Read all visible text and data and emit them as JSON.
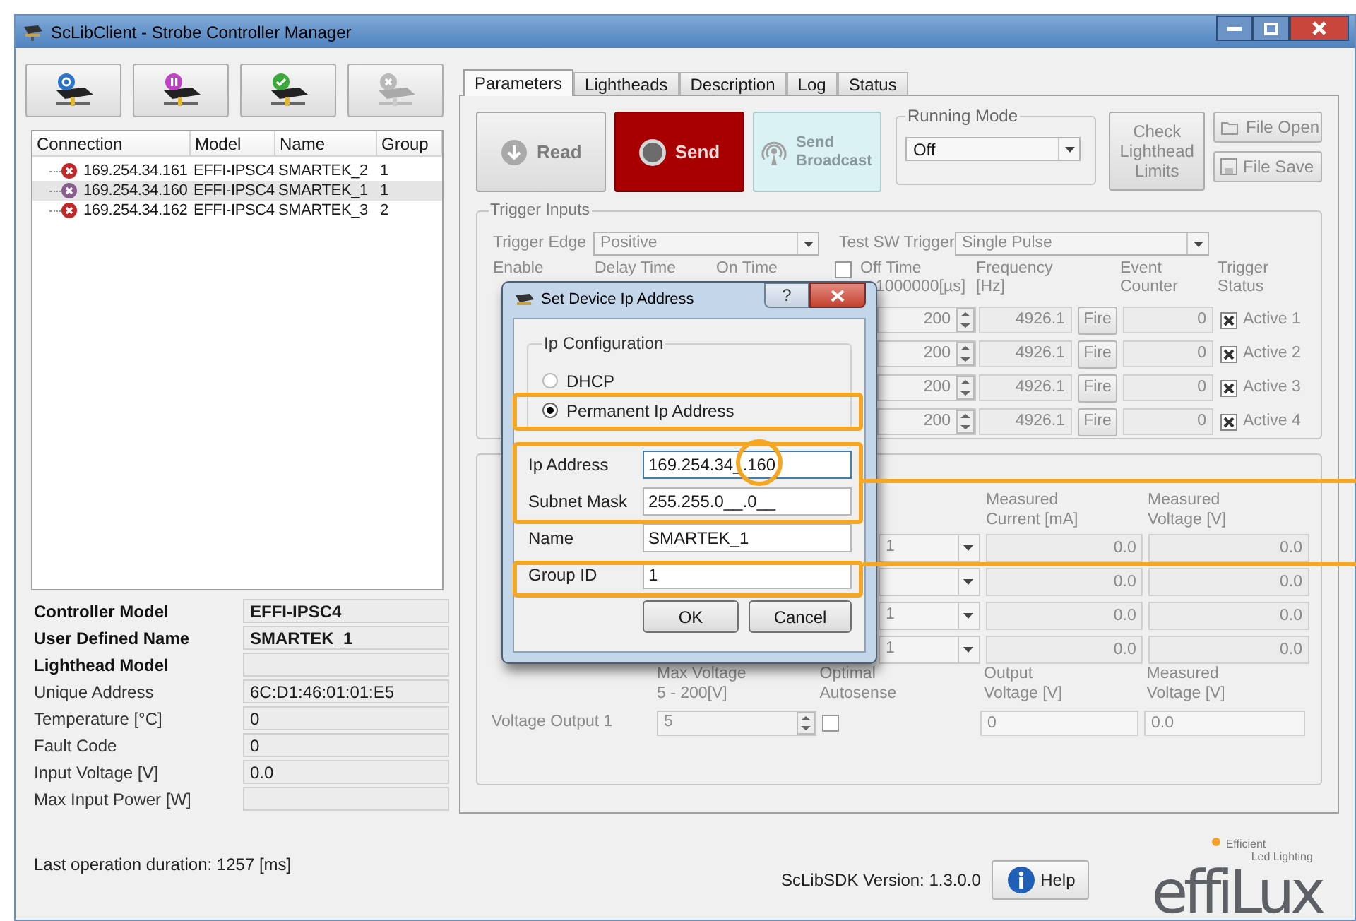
{
  "window": {
    "title": "ScLibClient - Strobe Controller Manager"
  },
  "toolbar": [
    {
      "kind": "find",
      "disabled": false
    },
    {
      "kind": "ip",
      "disabled": false
    },
    {
      "kind": "connect",
      "disabled": false
    },
    {
      "kind": "disconnect",
      "disabled": true
    }
  ],
  "connections": {
    "columns": [
      "Connection",
      "Model",
      "Name",
      "Group"
    ],
    "rows": [
      {
        "connection": "169.254.34.161",
        "model": "EFFI-IPSC4",
        "name": "SMARTEK_2",
        "group": "1",
        "selected": false
      },
      {
        "connection": "169.254.34.160",
        "model": "EFFI-IPSC4",
        "name": "SMARTEK_1",
        "group": "1",
        "selected": true
      },
      {
        "connection": "169.254.34.162",
        "model": "EFFI-IPSC4",
        "name": "SMARTEK_3",
        "group": "2",
        "selected": false
      }
    ]
  },
  "properties": [
    {
      "label": "Controller Model",
      "value": "EFFI-IPSC4",
      "bold": true
    },
    {
      "label": "User Defined Name",
      "value": "SMARTEK_1",
      "bold": true
    },
    {
      "label": "Lighthead Model",
      "bold": true
    },
    {
      "label": "Unique Address",
      "value": "6C:D1:46:01:01:E5",
      "bold": false
    },
    {
      "label": "Temperature [°C]",
      "value": "0",
      "bold": false
    },
    {
      "label": "Fault Code",
      "value": "0",
      "bold": false
    },
    {
      "label": "Input Voltage [V]",
      "value": "0.0",
      "bold": false
    },
    {
      "label": "Max Input Power [W]",
      "bold": false
    }
  ],
  "last_operation": "Last operation duration:  1257 [ms]",
  "tabs": [
    {
      "label": "Parameters",
      "selected": true
    },
    {
      "label": "Lightheads",
      "selected": false
    },
    {
      "label": "Description",
      "selected": false
    },
    {
      "label": "Log",
      "selected": false
    },
    {
      "label": "Status",
      "selected": false
    }
  ],
  "actions": [
    {
      "kind": "read",
      "label": "Read"
    },
    {
      "kind": "send",
      "label": "Send"
    },
    {
      "kind": "broadcast",
      "label": "Send Broadcast"
    }
  ],
  "running_mode": {
    "title": "Running Mode",
    "value": "Off"
  },
  "check_limits": "Check Lighthead Limits",
  "file_buttons": [
    {
      "kind": "open",
      "label": "File Open",
      "disabled": true
    },
    {
      "kind": "save",
      "label": "File Save",
      "disabled": true
    }
  ],
  "trigger_inputs": {
    "title": "Trigger Inputs",
    "edge_label": "Trigger Edge",
    "edge_value": "Positive",
    "test_label": "Test SW Trigger",
    "test_value": "Single Pulse",
    "off_time_enabled": false,
    "columns": [
      [
        "Enable"
      ],
      [
        "Delay Time"
      ],
      [
        "On Time"
      ],
      [
        "Off Time",
        "1000000[µs]"
      ],
      [
        "Frequency",
        "[Hz]"
      ],
      [
        "Event",
        "Counter"
      ],
      [
        "Trigger",
        "Status"
      ]
    ],
    "rows": [
      {
        "off_time": "200",
        "frequency": "4926.1",
        "fire": "Fire",
        "counter": "0",
        "active": true,
        "status": "Active 1"
      },
      {
        "off_time": "200",
        "frequency": "4926.1",
        "fire": "Fire",
        "counter": "0",
        "active": true,
        "status": "Active 2"
      },
      {
        "off_time": "200",
        "frequency": "4926.1",
        "fire": "Fire",
        "counter": "0",
        "active": true,
        "status": "Active 3"
      },
      {
        "off_time": "200",
        "frequency": "4926.1",
        "fire": "Fire",
        "counter": "0",
        "active": true,
        "status": "Active 4"
      }
    ]
  },
  "lighthead": {
    "columns": [
      [
        "Measured",
        "Current [mA]"
      ],
      [
        "Measured",
        "Voltage [V]"
      ]
    ],
    "rows": [
      {
        "channel": "1",
        "current": "0.0",
        "voltage": "0.0"
      },
      {
        "current": "0.0",
        "voltage": "0.0"
      },
      {
        "channel": "1",
        "current": "0.0",
        "voltage": "0.0"
      },
      {
        "channel": "1",
        "current": "0.0",
        "voltage": "0.0"
      }
    ],
    "output_columns": [
      [
        "Max Voltage",
        "5 - 200[V]"
      ],
      [
        "Optimal",
        "Autosense"
      ],
      [
        "Output",
        "Voltage [V]"
      ],
      [
        "Measured",
        "Voltage [V]"
      ]
    ],
    "output": {
      "label": "Voltage Output 1",
      "max_voltage": "5",
      "autosense": false,
      "output_voltage": "0",
      "measured_voltage": "0.0"
    }
  },
  "footer": {
    "version_label": "ScLibSDK Version:",
    "version": "1.3.0.0",
    "help": "Help"
  },
  "logo": {
    "name": "effiLux",
    "tagline": [
      "Efficient",
      "Led Lighting"
    ]
  },
  "dialog": {
    "title": "Set Device Ip Address",
    "help": "?",
    "group_title": "Ip Configuration",
    "modes": [
      {
        "label": "DHCP",
        "selected": false
      },
      {
        "label": "Permanent Ip Address",
        "selected": true
      }
    ],
    "fields": [
      {
        "label": "Ip Address",
        "value": "169.254.34_.160",
        "focused": true
      },
      {
        "label": "Subnet Mask",
        "value": "255.255.0__.0__",
        "focused": false
      },
      {
        "label": "Name",
        "value": "SMARTEK_1",
        "focused": false
      },
      {
        "label": "Group ID",
        "value": "1",
        "focused": false
      }
    ],
    "ok": "OK",
    "cancel": "Cancel"
  }
}
